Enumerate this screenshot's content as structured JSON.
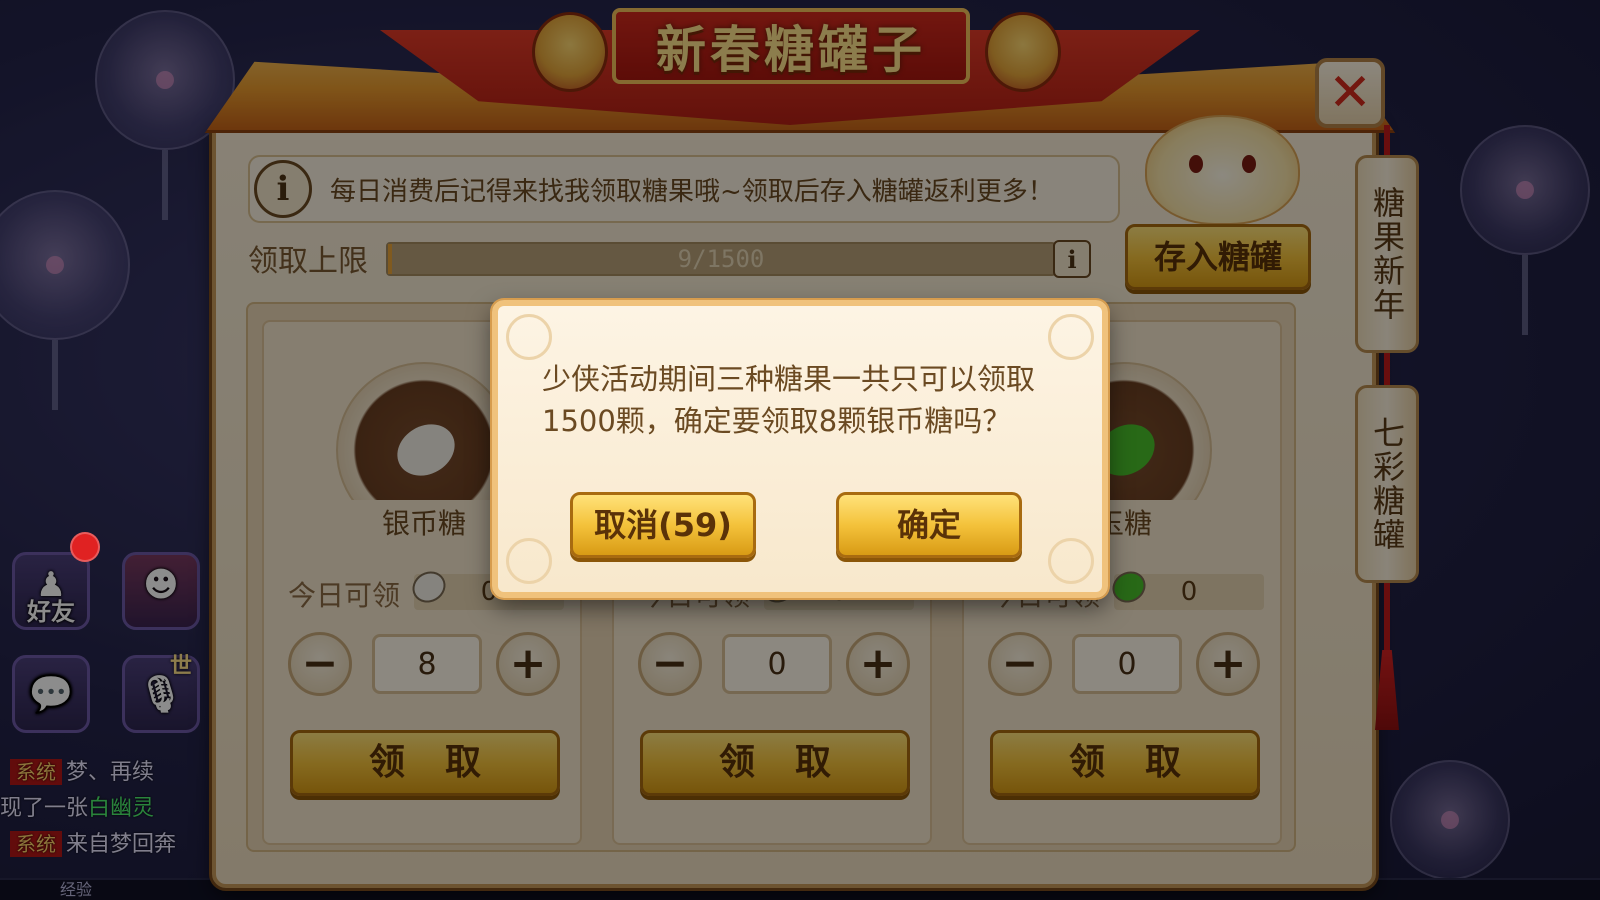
{
  "header": {
    "title": "新春糖罐子",
    "close_icon_glyph": "✕"
  },
  "info": {
    "icon_glyph": "i",
    "text": "每日消费后记得来找我领取糖果哦~领取后存入糖罐返利更多！"
  },
  "limit": {
    "label": "领取上限",
    "value_text": "9/1500",
    "current": 9,
    "max": 1500,
    "info_glyph": "i"
  },
  "store_button": "存入糖罐",
  "side_tabs": [
    {
      "label": "糖果新年"
    },
    {
      "label": "七彩糖罐"
    }
  ],
  "cards": [
    {
      "name": "银币糖",
      "today_label": "今日可领",
      "today_value": "0",
      "quantity": "8",
      "claim_label": "领取",
      "candy_color": "#f2efe6"
    },
    {
      "name": "",
      "today_label": "今日可领",
      "today_value": "0",
      "quantity": "0",
      "claim_label": "领取",
      "candy_color": "#e0a52a"
    },
    {
      "name": "玉糖",
      "today_label": "今日可领",
      "today_value": "0",
      "quantity": "0",
      "claim_label": "领取",
      "candy_color": "#49c02b"
    }
  ],
  "stepper": {
    "minus_glyph": "−",
    "plus_glyph": "+"
  },
  "dialog": {
    "message": "少侠活动期间三种糖果一共只可以领取1500颗，确定要领取8颗银币糖吗？",
    "cancel_label": "取消(59)",
    "confirm_label": "确定"
  },
  "hud": {
    "friends_label": "好友",
    "friends_glyph": "♟",
    "chat_glyph": "💬",
    "mic_glyph": "🎙",
    "world_tag": "世",
    "exp_label": "经验"
  },
  "chat": [
    {
      "tag": "系统",
      "text": "梦、再续",
      "highlight": ""
    },
    {
      "tag": "",
      "text": "现了一张",
      "highlight": "白幽灵"
    },
    {
      "tag": "系统",
      "text": "来自梦回奔",
      "highlight": ""
    }
  ],
  "colors": {
    "accent_gold": "#f4c23b",
    "banner_red": "#c0261a",
    "panel_bg": "#f7ecd6"
  }
}
